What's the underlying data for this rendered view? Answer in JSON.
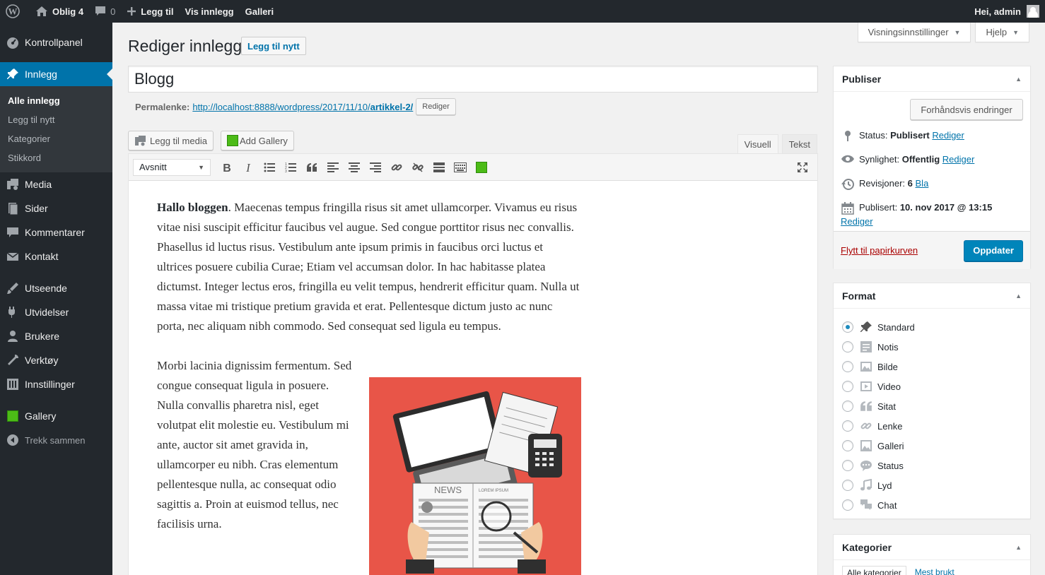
{
  "adminbar": {
    "wp_icon": "wordpress-icon",
    "site_name": "Oblig 4",
    "comments_count": "0",
    "new_label": "Legg til",
    "view_post": "Vis innlegg",
    "gallery": "Galleri",
    "greeting": "Hei, admin"
  },
  "sidebar": {
    "items": [
      {
        "label": "Kontrollpanel",
        "icon": "dashboard-icon"
      },
      {
        "label": "Innlegg",
        "icon": "pin-icon"
      },
      {
        "label": "Media",
        "icon": "media-icon"
      },
      {
        "label": "Sider",
        "icon": "pages-icon"
      },
      {
        "label": "Kommentarer",
        "icon": "comments-icon"
      },
      {
        "label": "Kontakt",
        "icon": "mail-icon"
      },
      {
        "label": "Utseende",
        "icon": "appearance-icon"
      },
      {
        "label": "Utvidelser",
        "icon": "plugins-icon"
      },
      {
        "label": "Brukere",
        "icon": "users-icon"
      },
      {
        "label": "Verktøy",
        "icon": "tools-icon"
      },
      {
        "label": "Innstillinger",
        "icon": "settings-icon"
      },
      {
        "label": "Gallery",
        "icon": "gallery-icon"
      },
      {
        "label": "Trekk sammen",
        "icon": "collapse-icon"
      }
    ],
    "submenu": [
      "Alle innlegg",
      "Legg til nytt",
      "Kategorier",
      "Stikkord"
    ]
  },
  "screen": {
    "options": "Visningsinnstillinger",
    "help": "Hjelp"
  },
  "page": {
    "title": "Rediger innlegg",
    "add_new": "Legg til nytt",
    "post_title": "Blogg",
    "permalink_label": "Permalenke:",
    "permalink_base": "http://localhost:8888/wordpress/2017/11/10/",
    "permalink_slug": "artikkel-2/",
    "edit_btn": "Rediger"
  },
  "editor": {
    "add_media": "Legg til media",
    "add_gallery": "Add Gallery",
    "tab_visual": "Visuell",
    "tab_text": "Tekst",
    "format": "Avsnitt",
    "p1_bold": "Hallo bloggen",
    "p1_rest": ". Maecenas tempus fringilla risus sit amet ullamcorper. Vivamus eu risus vitae nisi suscipit efficitur faucibus vel augue. Sed congue porttitor risus nec convallis. Phasellus id luctus risus. Vestibulum ante ipsum primis in faucibus orci luctus et ultrices posuere cubilia Curae; Etiam vel accumsan dolor. In hac habitasse platea dictumst. Integer lectus eros, fringilla eu velit tempus, hendrerit efficitur quam. Nulla ut massa vitae mi tristique pretium gravida et erat. Pellentesque dictum justo ac nunc porta, nec aliquam nibh commodo. Sed consequat sed ligula eu tempus.",
    "p2": "Morbi lacinia dignissim fermentum. Sed congue consequat ligula in posuere. Nulla convallis pharetra nisl, eget volutpat elit molestie eu. Vestibulum mi ante, auctor sit amet gravida in, ullamcorper eu nibh. Cras elementum pellentesque nulla, ac consequat odio sagittis a. Proin at euismod tellus, nec facilisis urna.",
    "img_news": "NEWS",
    "img_lorem": "LOREM IPSUM"
  },
  "publish": {
    "title": "Publiser",
    "preview": "Forhåndsvis endringer",
    "status_label": "Status:",
    "status_value": "Publisert",
    "visibility_label": "Synlighet:",
    "visibility_value": "Offentlig",
    "revisions_label": "Revisjoner:",
    "revisions_value": "6",
    "browse": "Bla",
    "published_label": "Publisert:",
    "published_value": "10. nov 2017 @ 13:15",
    "edit": "Rediger",
    "trash": "Flytt til papirkurven",
    "update": "Oppdater"
  },
  "format": {
    "title": "Format",
    "options": [
      {
        "label": "Standard",
        "icon": "pin-icon",
        "checked": true
      },
      {
        "label": "Notis",
        "icon": "aside-icon",
        "checked": false
      },
      {
        "label": "Bilde",
        "icon": "image-icon",
        "checked": false
      },
      {
        "label": "Video",
        "icon": "video-icon",
        "checked": false
      },
      {
        "label": "Sitat",
        "icon": "quote-icon",
        "checked": false
      },
      {
        "label": "Lenke",
        "icon": "link-icon",
        "checked": false
      },
      {
        "label": "Galleri",
        "icon": "gallery-icon",
        "checked": false
      },
      {
        "label": "Status",
        "icon": "status-icon",
        "checked": false
      },
      {
        "label": "Lyd",
        "icon": "audio-icon",
        "checked": false
      },
      {
        "label": "Chat",
        "icon": "chat-icon",
        "checked": false
      }
    ]
  },
  "categories": {
    "title": "Kategorier",
    "tab_all": "Alle kategorier",
    "tab_most": "Mest brukt"
  },
  "colors": {
    "adminbar": "#23282d",
    "accent": "#0073aa",
    "primary_button": "#0085ba",
    "trash": "#a00",
    "image_bg": "#e85548"
  }
}
